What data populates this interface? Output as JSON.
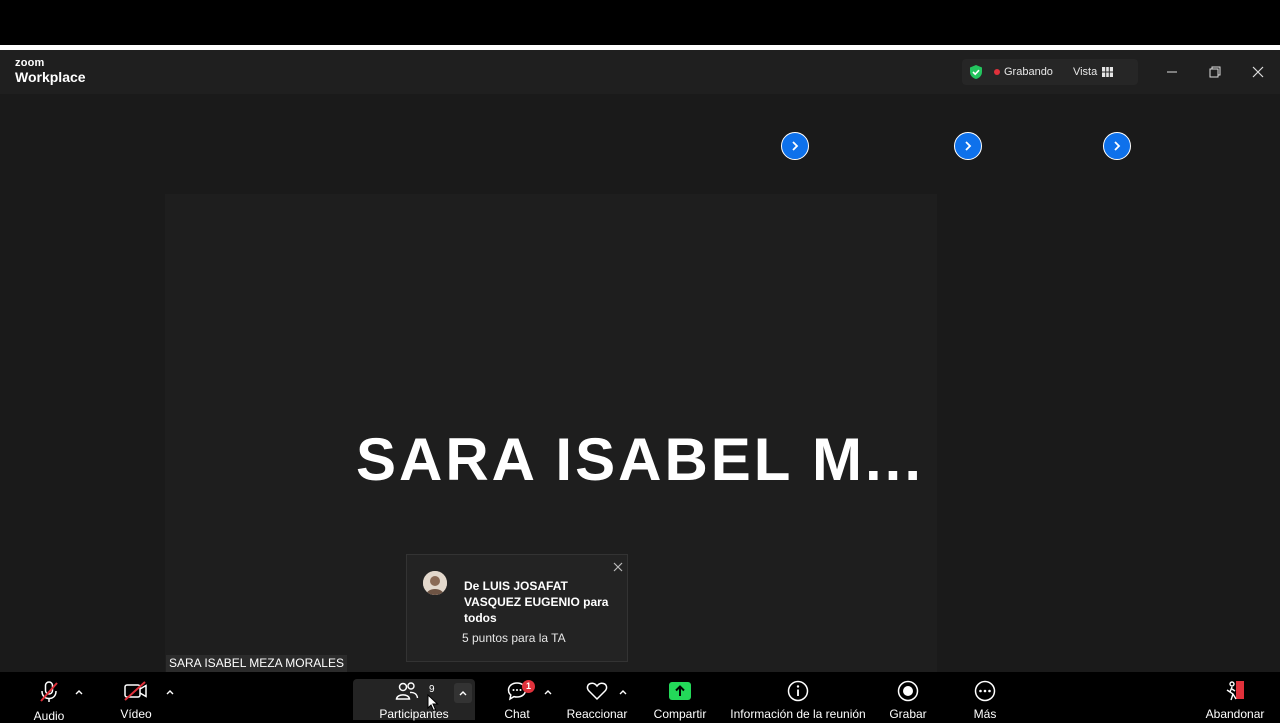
{
  "app": {
    "logo_small": "zoom",
    "logo_big": "Workplace"
  },
  "titlebar": {
    "recording_label": "Grabando",
    "view_label": "Vista"
  },
  "meeting": {
    "speaker_display_name": "SARA ISABEL M...",
    "speaker_name_label": "SARA ISABEL MEZA  MORALES"
  },
  "chat_notification": {
    "from": "De LUIS JOSAFAT VASQUEZ EUGENIO para todos",
    "message": "5 puntos para la TA"
  },
  "toolbar": {
    "audio": "Audio",
    "video": "Vídeo",
    "participants": "Participantes",
    "participants_count": "9",
    "chat": "Chat",
    "chat_badge": "1",
    "react": "Reaccionar",
    "share": "Compartir",
    "meeting_info": "Información de la reunión",
    "record": "Grabar",
    "more": "Más",
    "leave": "Abandonar"
  },
  "colors": {
    "accent_blue": "#0e71eb",
    "share_green": "#23d959",
    "recording_red": "#e0313b",
    "shield_green": "#23c45e"
  }
}
